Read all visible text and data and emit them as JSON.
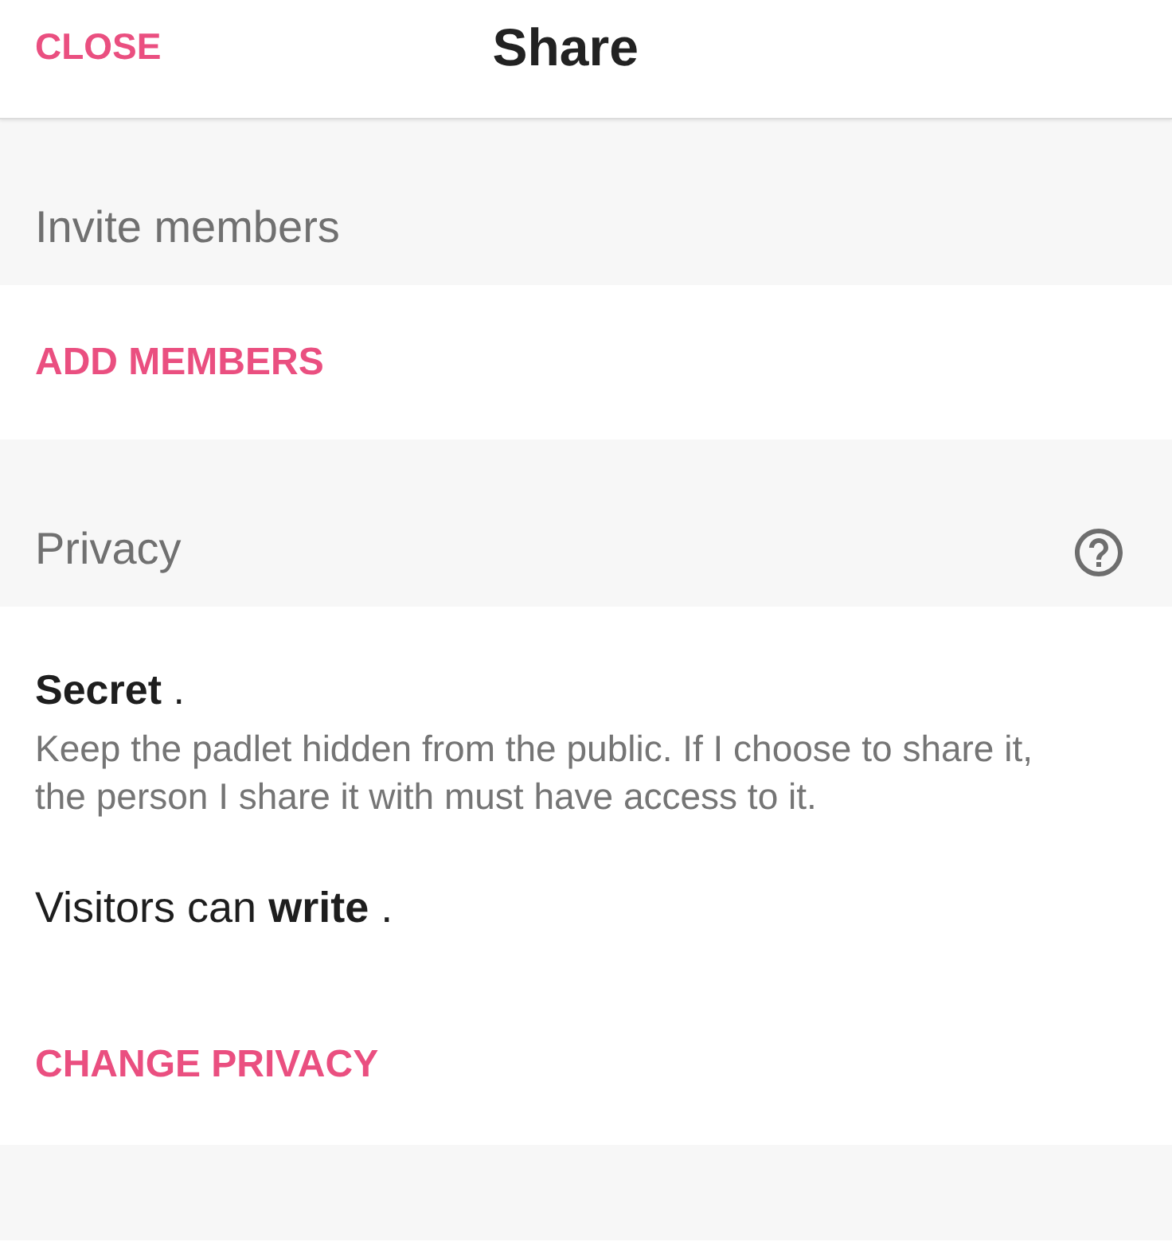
{
  "header": {
    "close_button": "CLOSE",
    "title": "Share"
  },
  "invite": {
    "heading": "Invite members",
    "add_button": "ADD MEMBERS"
  },
  "privacy": {
    "heading": "Privacy",
    "setting": "**Secret** .",
    "description": "Keep the padlet hidden from the public. If I choose to share it, the person I share it with must have access to it.",
    "visitors": "Visitors can **write** .",
    "change_button": "CHANGE PRIVACY"
  }
}
